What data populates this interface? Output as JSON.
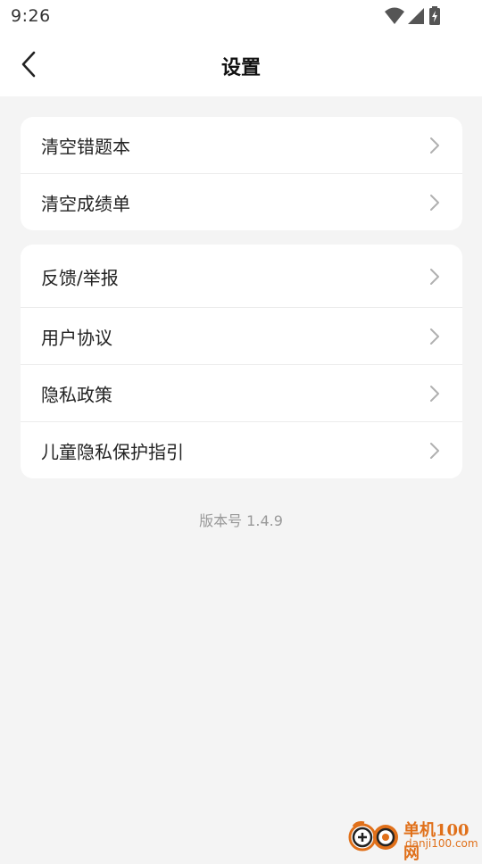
{
  "status_bar": {
    "time": "9:26",
    "icons": [
      "wifi-icon",
      "cell-signal-icon",
      "battery-charging-icon"
    ]
  },
  "nav": {
    "title": "设置",
    "back_icon": "chevron-left-icon"
  },
  "group1": {
    "items": [
      {
        "label": "清空错题本"
      },
      {
        "label": "清空成绩单"
      }
    ]
  },
  "group2": {
    "items": [
      {
        "label": "反馈/举报"
      },
      {
        "label": "用户协议"
      },
      {
        "label": "隐私政策"
      },
      {
        "label": "儿童隐私保护指引"
      }
    ]
  },
  "version_text": "版本号 1.4.9",
  "watermark": {
    "name": "单机100网",
    "url": "danji100.com"
  },
  "colors": {
    "background": "#f4f4f4",
    "card": "#ffffff",
    "chevron": "#b0b0b0",
    "version_text": "#999999",
    "watermark": "#e0701a"
  }
}
